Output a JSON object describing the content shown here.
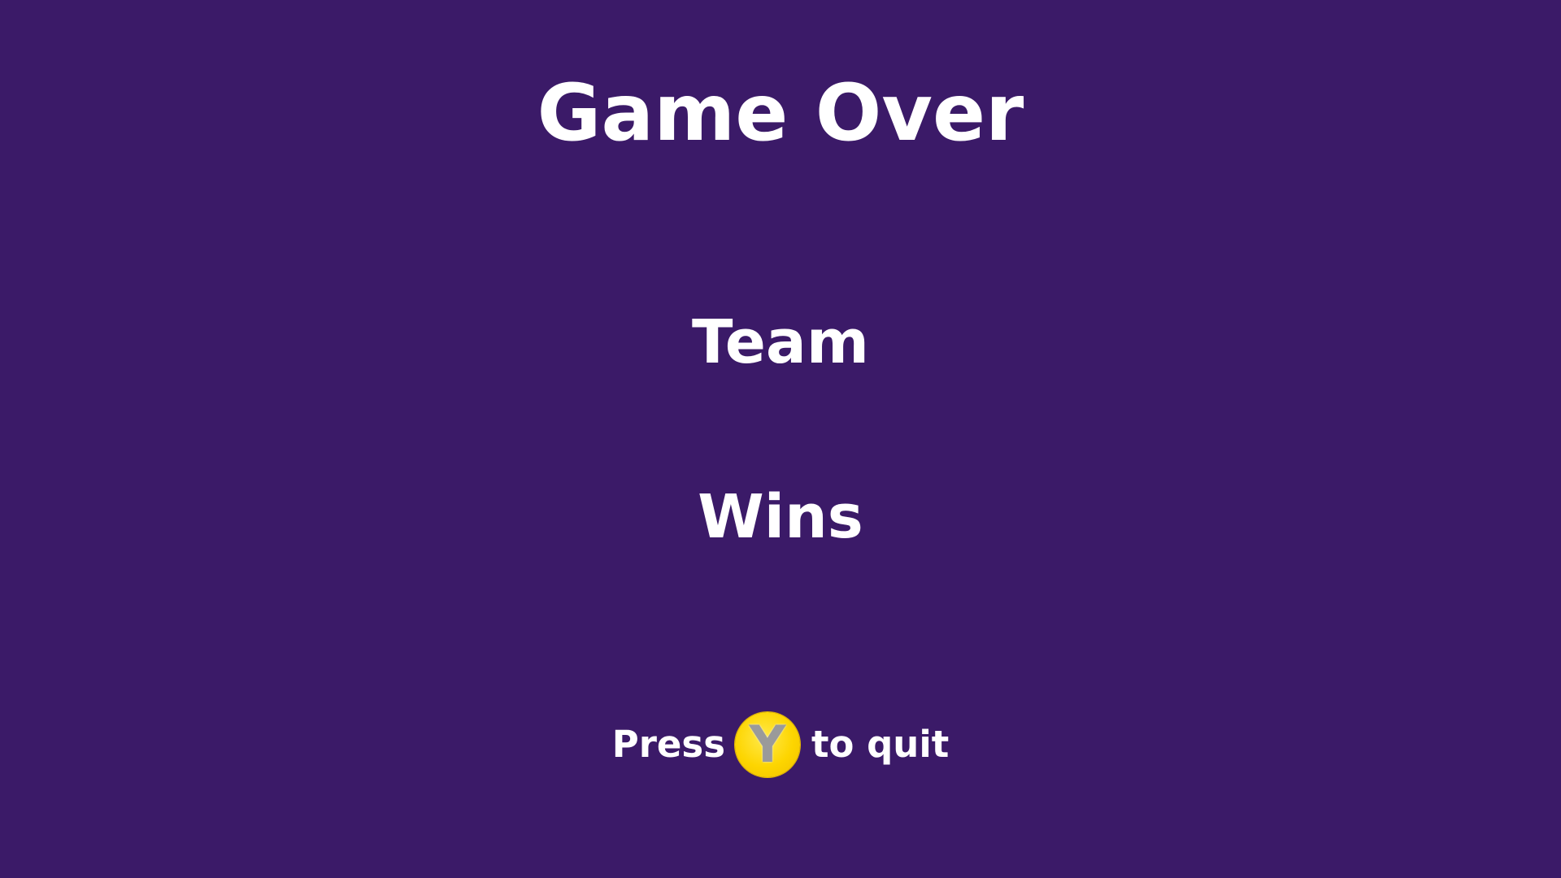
{
  "screen": {
    "title": "Game Over",
    "team_label": "Team",
    "result_label": "Wins",
    "background_color": "#3b1a68",
    "text_color": "#ffffff"
  },
  "quit_prompt": {
    "before": "Press",
    "button_glyph": "Y",
    "button_icon": "y-button-icon",
    "button_color": "#fdd500",
    "after": "to quit"
  }
}
